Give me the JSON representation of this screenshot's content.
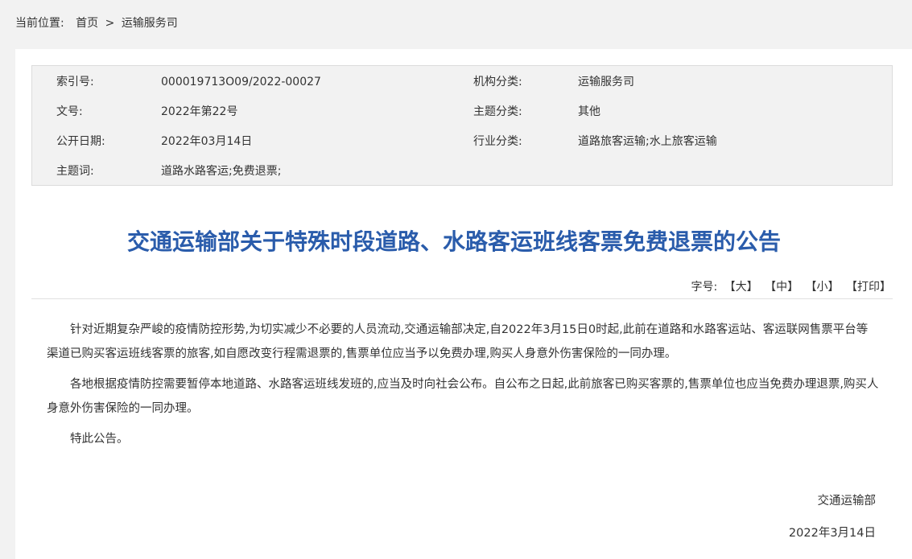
{
  "breadcrumb": {
    "lead": "当前位置:",
    "home": "首页",
    "sep": ">",
    "current": "运输服务司"
  },
  "meta": {
    "index_label": "索引号:",
    "index_value": "000019713O09/2022-00027",
    "org_label": "机构分类:",
    "org_value": "运输服务司",
    "doc_label": "文号:",
    "doc_value": "2022年第22号",
    "topic_label": "主题分类:",
    "topic_value": "其他",
    "date_label": "公开日期:",
    "date_value": "2022年03月14日",
    "industry_label": "行业分类:",
    "industry_value": "道路旅客运输;水上旅客运输",
    "keywords_label": "主题词:",
    "keywords_value": "道路水路客运;免费退票;"
  },
  "article": {
    "title": "交通运输部关于特殊时段道路、水路客运班线客票免费退票的公告",
    "font_label": "字号:",
    "font_large": "【大】",
    "font_medium": "【中】",
    "font_small": "【小】",
    "print": "【打印】",
    "paragraphs": [
      "针对近期复杂严峻的疫情防控形势,为切实减少不必要的人员流动,交通运输部决定,自2022年3月15日0时起,此前在道路和水路客运站、客运联网售票平台等渠道已购买客运班线客票的旅客,如自愿改变行程需退票的,售票单位应当予以免费办理,购买人身意外伤害保险的一同办理。",
      "各地根据疫情防控需要暂停本地道路、水路客运班线发班的,应当及时向社会公布。自公布之日起,此前旅客已购买客票的,售票单位也应当免费办理退票,购买人身意外伤害保险的一同办理。",
      "特此公告。"
    ],
    "signature": "交通运输部",
    "sign_date": "2022年3月14日"
  },
  "colors": {
    "title": "#2a5cab",
    "page_bg": "#f2f2f2",
    "meta_bg": "#f2f2f2"
  }
}
